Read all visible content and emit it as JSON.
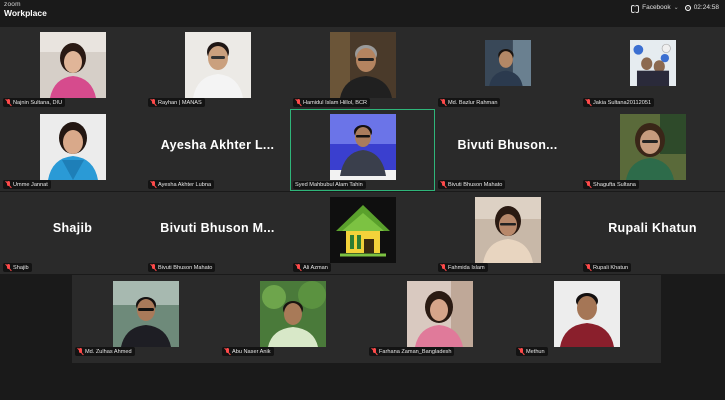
{
  "app": {
    "brand_small": "zoom",
    "brand_large": "Workplace"
  },
  "topbar": {
    "live_label": "Facebook",
    "elapsed": "02:24:58"
  },
  "colors": {
    "active_border": "#2fb57a",
    "muted_icon": "#ff4a4a",
    "tile_bg": "#2a2a2a",
    "page_bg": "#1a1a1a"
  },
  "participants": [
    {
      "name": "Najnin Sultana, DIU",
      "video": true,
      "photo": "woman-pink"
    },
    {
      "name": "Rayhan | MANAS",
      "video": true,
      "photo": "man-white-shirt"
    },
    {
      "name": "Hamidul Islam Hillol, BCR",
      "video": true,
      "photo": "man-glasses-dark"
    },
    {
      "name": "Md. Bazlur Rahman",
      "video": true,
      "photo": "man-window"
    },
    {
      "name": "Jakia Sultana20112051",
      "video": true,
      "photo": "people-balloons"
    },
    {
      "name": "Umme Jannat",
      "video": true,
      "photo": "woman-blue-saree"
    },
    {
      "name": "Ayesha Akhter Lubna",
      "video": false,
      "display": "Ayesha Akhter L..."
    },
    {
      "name": "Syed Mahbubul Alam Tahin",
      "video": true,
      "photo": "man-speaker-stage",
      "active": true
    },
    {
      "name": "Bivuti Bhuson Mahato",
      "video": false,
      "display": "Bivuti Bhuson..."
    },
    {
      "name": "Shagufta Sultana",
      "video": true,
      "photo": "woman-glasses-green"
    },
    {
      "name": "Shajib",
      "video": false,
      "display": "Shajib"
    },
    {
      "name": "Bivuti Bhuson Mahato",
      "video": false,
      "display": "Bivuti Bhuson M..."
    },
    {
      "name": "Ali Azman",
      "video": true,
      "photo": "logo-house-tree"
    },
    {
      "name": "Fahmida Islam",
      "video": true,
      "photo": "woman-cream"
    },
    {
      "name": "Rupali Khatun",
      "video": false,
      "display": "Rupali Khatun"
    },
    {
      "name": "Md. Zulhas Ahmed",
      "video": true,
      "photo": "man-glasses-river"
    },
    {
      "name": "Abu Naser Anik",
      "video": true,
      "photo": "man-outdoor-green"
    },
    {
      "name": "Farhana Zaman_Bangladesh",
      "video": true,
      "photo": "woman-selfie"
    },
    {
      "name": "Methun",
      "video": true,
      "photo": "man-maroon-shirt"
    }
  ]
}
